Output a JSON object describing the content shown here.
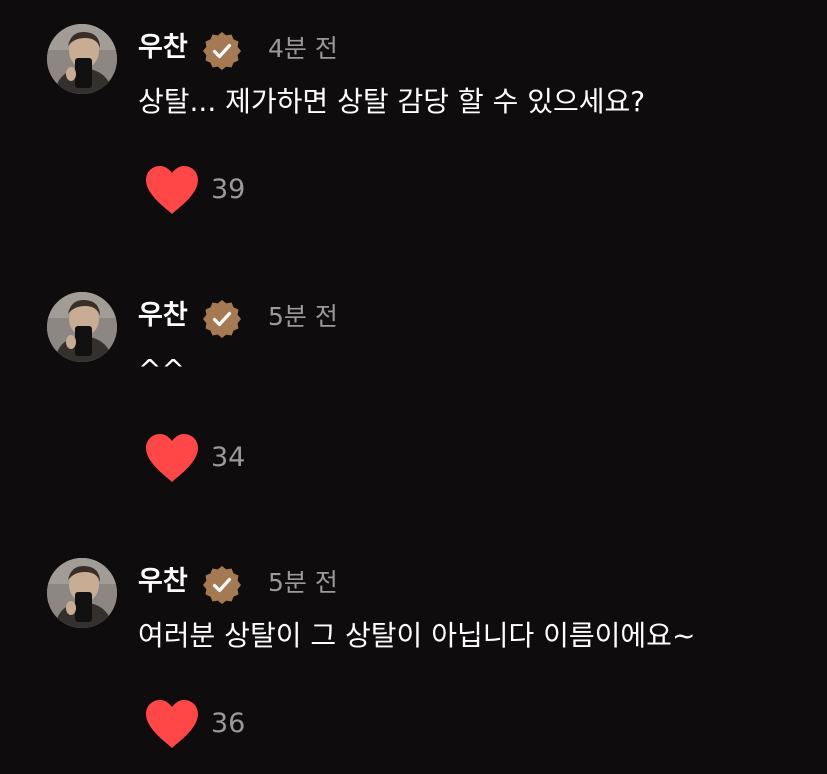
{
  "colors": {
    "background": "#0e0c0d",
    "verified_badge": "#a57a52",
    "heart": "#ff4747",
    "muted_text": "#9a9a9a"
  },
  "comments": [
    {
      "username": "우찬",
      "badge_icon": "verified-check-icon",
      "timestamp": "4분 전",
      "text": "상탈... 제가하면 상탈 감당 할 수 있으세요?",
      "like_icon": "heart-icon",
      "likes": "39"
    },
    {
      "username": "우찬",
      "badge_icon": "verified-check-icon",
      "timestamp": "5분 전",
      "text": "^^",
      "like_icon": "heart-icon",
      "likes": "34"
    },
    {
      "username": "우찬",
      "badge_icon": "verified-check-icon",
      "timestamp": "5분 전",
      "text": "여러분 상탈이 그 상탈이 아닙니다 이름이에요~",
      "like_icon": "heart-icon",
      "likes": "36"
    }
  ]
}
